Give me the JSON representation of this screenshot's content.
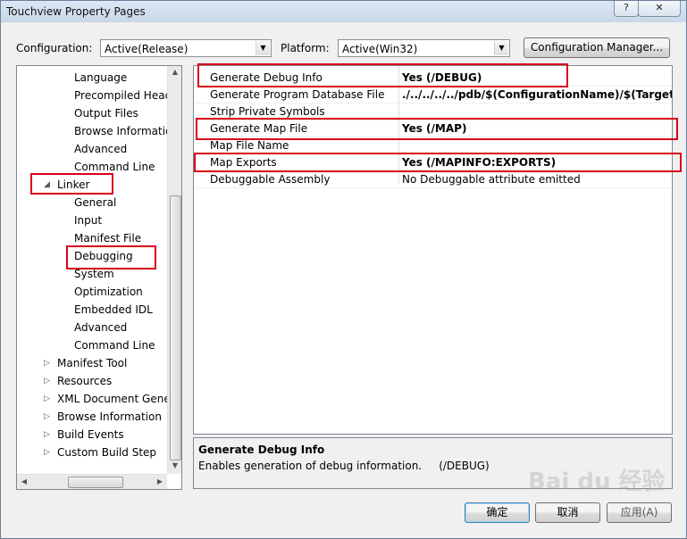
{
  "window": {
    "title": "Touchview Property Pages",
    "help_glyph": "?",
    "close_glyph": "✕"
  },
  "config": {
    "label": "Configuration:",
    "value": "Active(Release)"
  },
  "platform": {
    "label": "Platform:",
    "value": "Active(Win32)"
  },
  "config_manager_label": "Configuration Manager...",
  "tree": [
    {
      "label": "Language",
      "level": 2
    },
    {
      "label": "Precompiled Heac",
      "level": 2
    },
    {
      "label": "Output Files",
      "level": 2
    },
    {
      "label": "Browse Informatic",
      "level": 2
    },
    {
      "label": "Advanced",
      "level": 2
    },
    {
      "label": "Command Line",
      "level": 2
    },
    {
      "label": "Linker",
      "level": 1,
      "expanded": true
    },
    {
      "label": "General",
      "level": 2
    },
    {
      "label": "Input",
      "level": 2
    },
    {
      "label": "Manifest File",
      "level": 2
    },
    {
      "label": "Debugging",
      "level": 2,
      "selected": true
    },
    {
      "label": "System",
      "level": 2
    },
    {
      "label": "Optimization",
      "level": 2
    },
    {
      "label": "Embedded IDL",
      "level": 2
    },
    {
      "label": "Advanced",
      "level": 2
    },
    {
      "label": "Command Line",
      "level": 2
    },
    {
      "label": "Manifest Tool",
      "level": 1
    },
    {
      "label": "Resources",
      "level": 1
    },
    {
      "label": "XML Document Gene",
      "level": 1
    },
    {
      "label": "Browse Information",
      "level": 1
    },
    {
      "label": "Build Events",
      "level": 1
    },
    {
      "label": "Custom Build Step",
      "level": 1
    }
  ],
  "properties": [
    {
      "name": "Generate Debug Info",
      "value": "Yes (/DEBUG)",
      "bold": true
    },
    {
      "name": "Generate Program Database File",
      "value": "./../../../../pdb/$(ConfigurationName)/$(TargetNa",
      "bold": true
    },
    {
      "name": "Strip Private Symbols",
      "value": "",
      "bold": false
    },
    {
      "name": "Generate Map File",
      "value": "Yes (/MAP)",
      "bold": true
    },
    {
      "name": "Map File Name",
      "value": "",
      "bold": false
    },
    {
      "name": "Map Exports",
      "value": "Yes (/MAPINFO:EXPORTS)",
      "bold": true
    },
    {
      "name": "Debuggable Assembly",
      "value": "No Debuggable attribute emitted",
      "bold": false
    }
  ],
  "description": {
    "title": "Generate Debug Info",
    "text": "Enables generation of debug information.     (/DEBUG)"
  },
  "buttons": {
    "ok": "确定",
    "cancel": "取消",
    "apply": "应用(A)"
  },
  "watermark": "Bai du 经验",
  "colors": {
    "highlight_box": "#d9001b",
    "default_button_border": "#3c7fb1"
  }
}
